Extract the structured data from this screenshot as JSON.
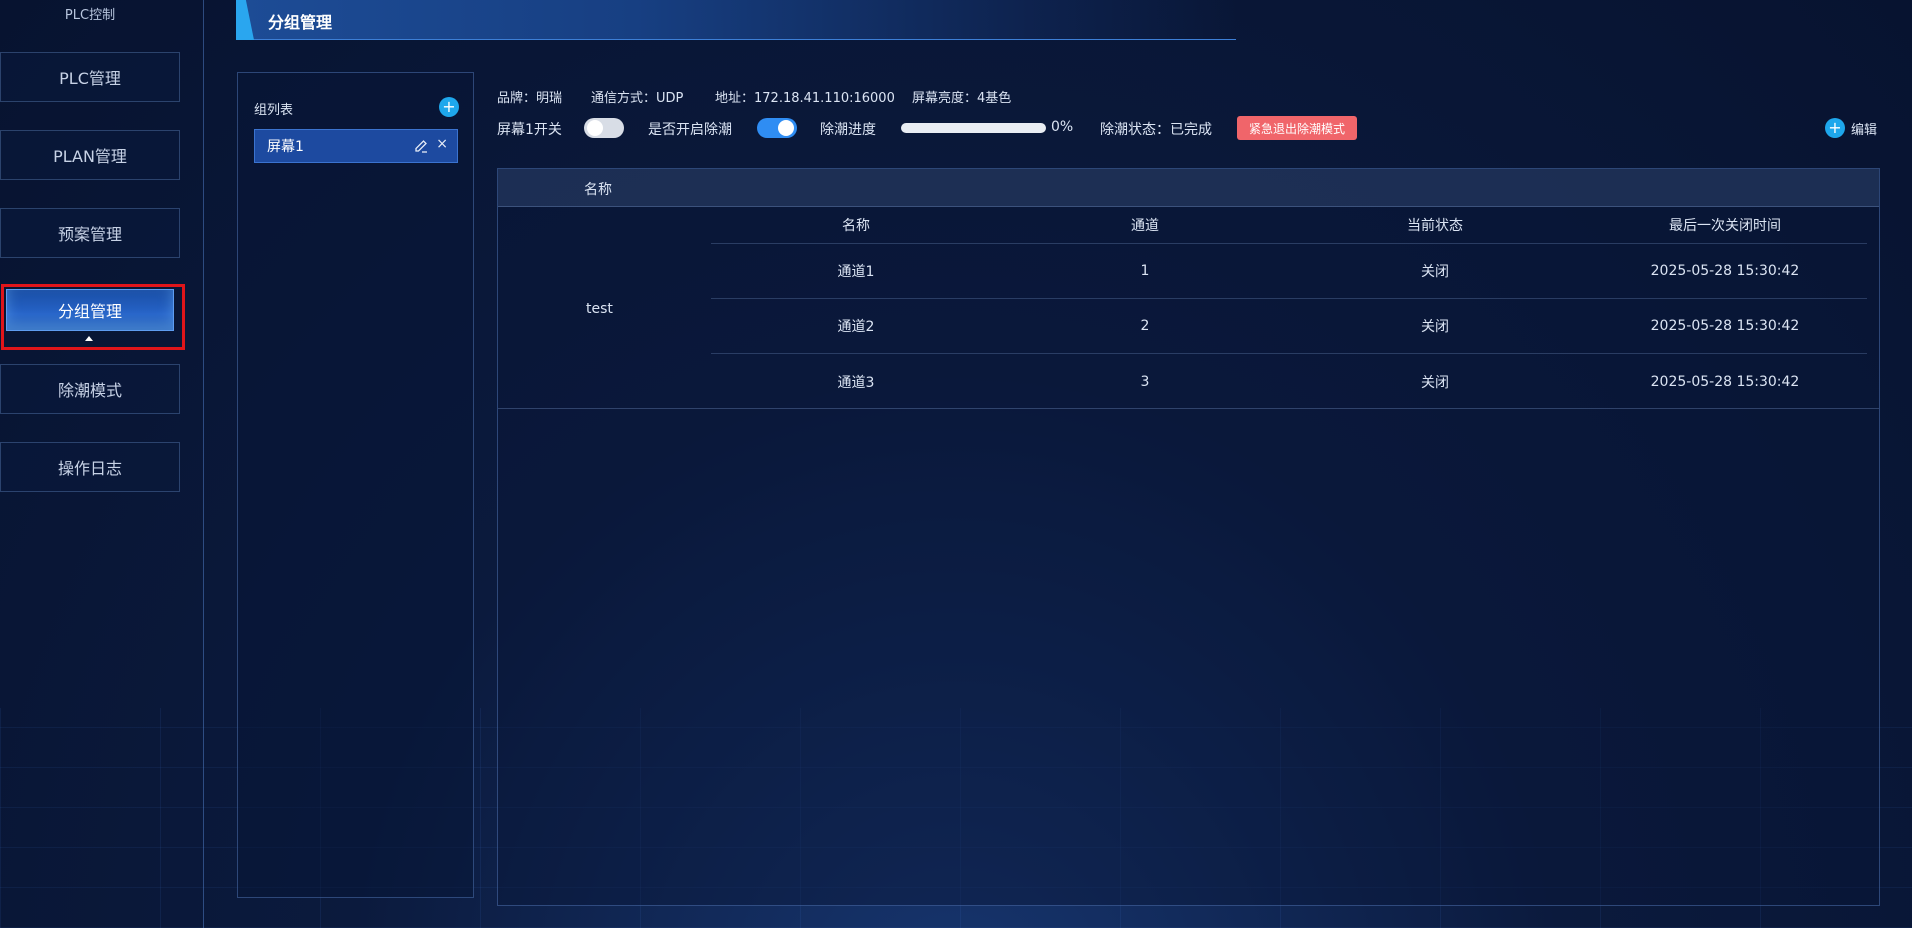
{
  "sidebar": {
    "title": "PLC控制",
    "items": [
      {
        "label": "PLC管理"
      },
      {
        "label": "PLAN管理"
      },
      {
        "label": "预案管理"
      },
      {
        "label": "分组管理"
      },
      {
        "label": "除潮模式"
      },
      {
        "label": "操作日志"
      }
    ],
    "active_index": 3
  },
  "header": {
    "title": "分组管理"
  },
  "group_list": {
    "title": "组列表",
    "add_icon": "+",
    "items": [
      {
        "label": "屏幕1",
        "close_glyph": "×"
      }
    ]
  },
  "info": {
    "brand": "品牌：明瑞",
    "comm": "通信方式：UDP",
    "address": "地址：172.18.41.110:16000",
    "brightness": "屏幕亮度：4基色"
  },
  "controls": {
    "screen_switch_label": "屏幕1开关",
    "screen_switch_on": false,
    "dehumid_enable_label": "是否开启除潮",
    "dehumid_enable_on": true,
    "progress_label": "除潮进度",
    "progress_value": 0,
    "progress_text": "0%",
    "status_text": "除潮状态：已完成",
    "emergency_button": "紧急退出除潮模式",
    "edit_button": "编辑",
    "edit_icon": "+"
  },
  "table": {
    "header_name": "名称",
    "groups": [
      {
        "name": "test",
        "sub_headers": [
          "名称",
          "通道",
          "当前状态",
          "最后一次关闭时间"
        ],
        "rows": [
          [
            "通道1",
            "1",
            "关闭",
            "2025-05-28 15:30:42"
          ],
          [
            "通道2",
            "2",
            "关闭",
            "2025-05-28 15:30:42"
          ],
          [
            "通道3",
            "3",
            "关闭",
            "2025-05-28 15:30:42"
          ]
        ]
      }
    ]
  },
  "colors": {
    "accent": "#2f8df3",
    "danger": "#f0656a",
    "active_frame": "#e0151a"
  }
}
